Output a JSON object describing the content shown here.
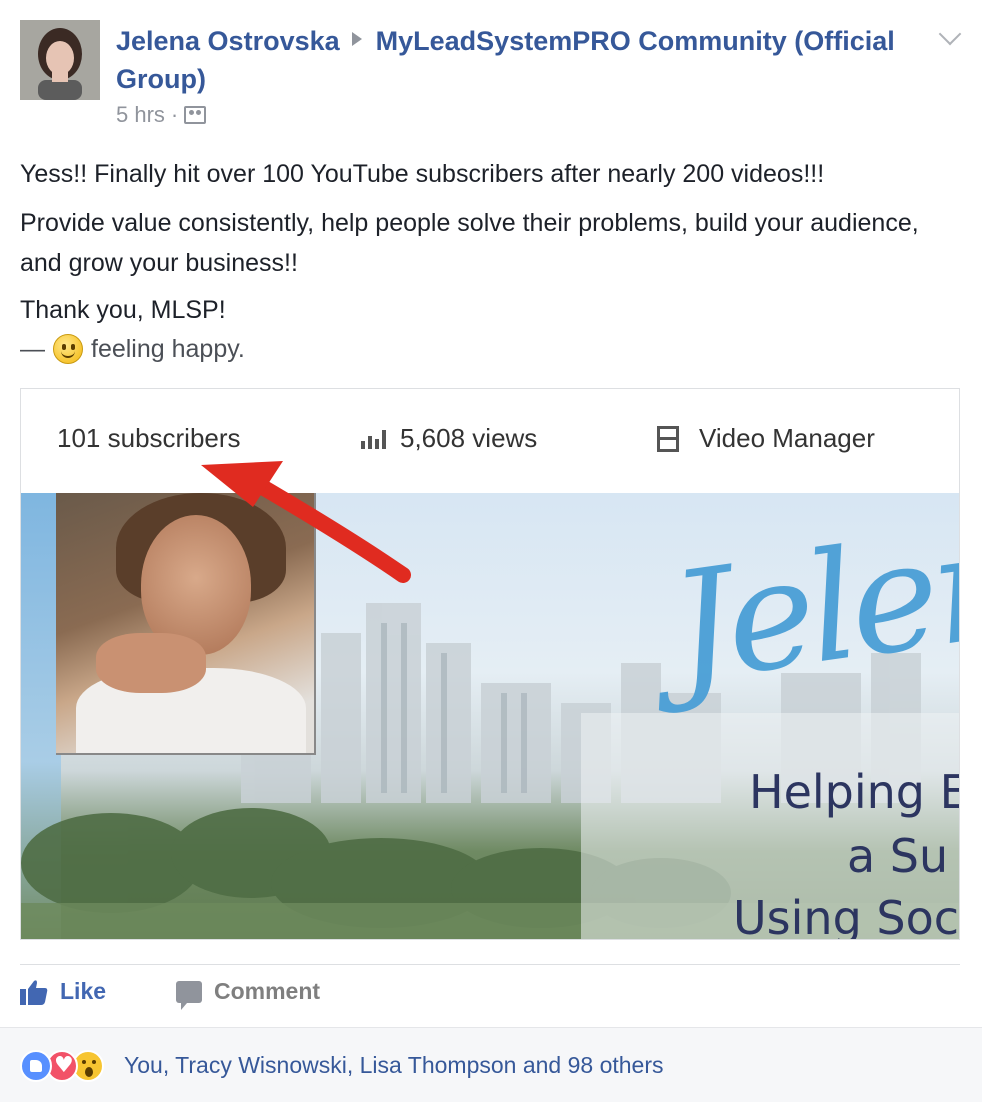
{
  "post": {
    "author": "Jelena Ostrovska",
    "group": "MyLeadSystemPRO Community (Official Group)",
    "timestamp": "5 hrs",
    "separator": "·",
    "paragraphs": [
      "Yess!! Finally hit over 100 YouTube subscribers after nearly 200 videos!!!",
      "Provide value consistently, help people solve their problems, build your audience, and grow your business!!",
      "Thank you, MLSP!"
    ],
    "feeling_prefix": "—",
    "feeling_text": "feeling happy."
  },
  "screenshot": {
    "subscribers": "101 subscribers",
    "views": "5,608 views",
    "video_manager": "Video Manager",
    "banner_name": "Jelena",
    "tagline": [
      "Helping E",
      "a Su",
      "Using Soc"
    ]
  },
  "actions": {
    "like": "Like",
    "comment": "Comment"
  },
  "reactions": {
    "summary": "You, Tracy Wisnowski, Lisa Thompson and 98 others"
  },
  "colors": {
    "link_blue": "#365899",
    "like_blue": "#4267b2",
    "arrow_red": "#e02b20"
  }
}
